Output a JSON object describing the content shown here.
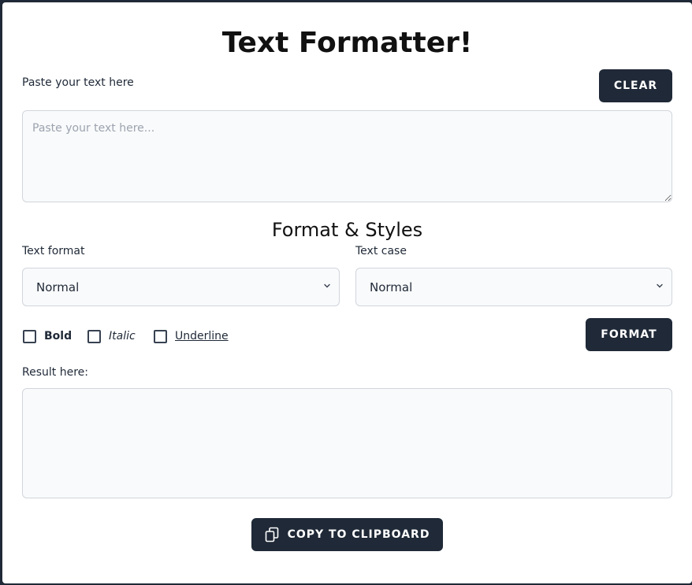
{
  "app": {
    "title": "Text Formatter!"
  },
  "input_section": {
    "label": "Paste your text here",
    "clear_label": "CLEAR",
    "placeholder": "Paste your text here...",
    "value": ""
  },
  "format_section": {
    "title": "Format & Styles",
    "text_format": {
      "label": "Text format",
      "selected": "Normal"
    },
    "text_case": {
      "label": "Text case",
      "selected": "Normal"
    },
    "checkboxes": {
      "bold": {
        "label": "Bold",
        "checked": false
      },
      "italic": {
        "label": "Italic",
        "checked": false
      },
      "underline": {
        "label": "Underline",
        "checked": false
      }
    },
    "format_label": "FORMAT"
  },
  "result_section": {
    "label": "Result here:",
    "value": ""
  },
  "copy_label": "COPY TO CLIPBOARD",
  "icons": {
    "copy": "copy-icon",
    "select_arrow": "chevron-down-icon"
  },
  "colors": {
    "button_bg": "#1f2937",
    "field_bg": "#f9fafb",
    "border": "#d1d5db"
  }
}
